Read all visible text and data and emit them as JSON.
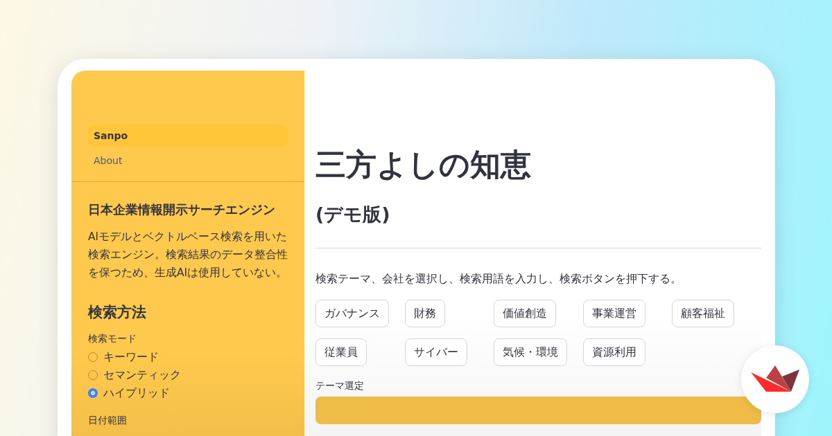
{
  "nav": [
    {
      "label": "Sanpo",
      "selected": true
    },
    {
      "label": "About",
      "selected": false
    }
  ],
  "sidebar": {
    "title": "日本企業情報開示サーチエンジン",
    "description": "AIモデルとベクトルベース検索を用いた検索エンジン。検索結果のデータ整合性を保つため、生成AIは使用していない。",
    "section_title": "検索方法",
    "search_mode": {
      "label": "検索モード",
      "options": [
        {
          "label": "キーワード",
          "selected": false
        },
        {
          "label": "セマンティック",
          "selected": false
        },
        {
          "label": "ハイブリッド",
          "selected": true
        }
      ]
    },
    "date_range": {
      "label": "日付範囲"
    }
  },
  "main": {
    "title": "三方よしの知恵",
    "subtitle": "(デモ版)",
    "instructions": "検索テーマ、会社を選択し、検索用語を入力し、検索ボタンを押下する。",
    "themes": [
      "ガバナンス",
      "財務",
      "価値創造",
      "事業運営",
      "顧客福祉",
      "従業員",
      "サイバー",
      "気候・環境",
      "資源利用"
    ],
    "theme_select": {
      "label": "テーマ選定"
    }
  }
}
